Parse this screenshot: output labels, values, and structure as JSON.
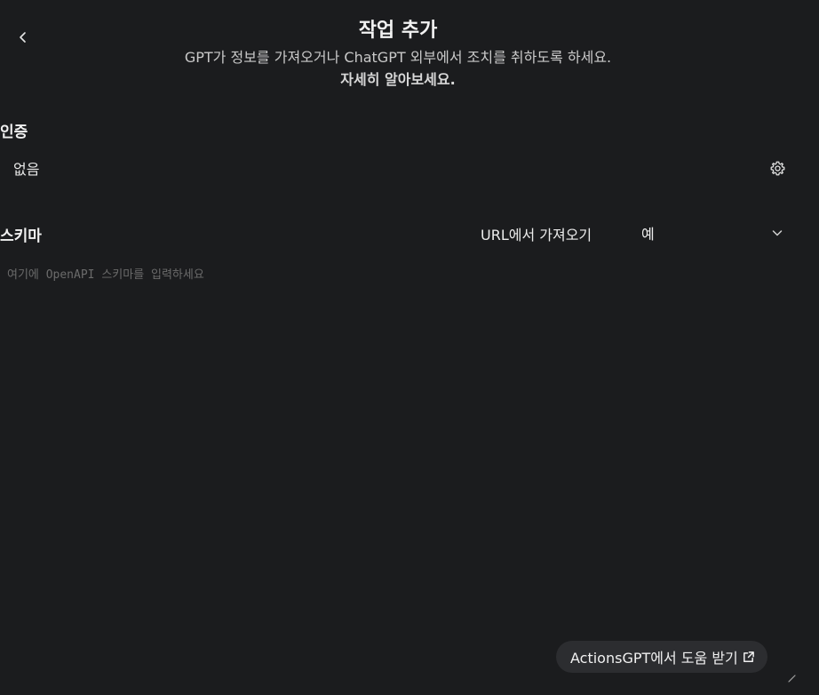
{
  "header": {
    "title": "작업 추가",
    "subtitle": "GPT가 정보를 가져오거나 ChatGPT 외부에서 조치를 취하도록 하세요.",
    "learn_more": "자세히 알아보세요."
  },
  "auth": {
    "label": "인증",
    "value": "없음"
  },
  "schema": {
    "label": "스키마",
    "import_url": "URL에서 가져오기",
    "example_selected": "예",
    "placeholder": "여기에 OpenAPI 스키마를 입력하세요"
  },
  "help": {
    "label": "ActionsGPT에서 도움 받기"
  },
  "icons": {
    "back": "chevron-left-icon",
    "settings": "gear-icon",
    "dropdown": "chevron-down-icon",
    "external": "external-link-icon"
  }
}
